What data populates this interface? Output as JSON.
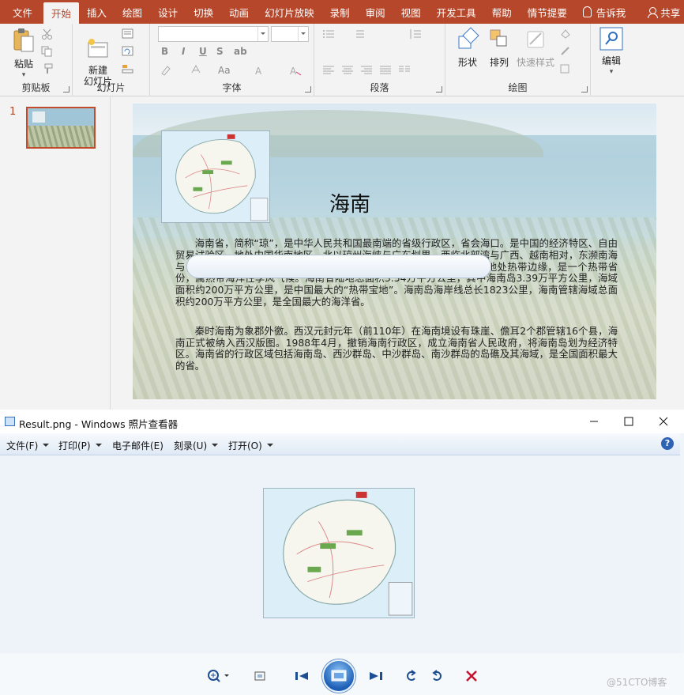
{
  "ppt": {
    "tabs": [
      "文件",
      "开始",
      "插入",
      "绘图",
      "设计",
      "切换",
      "动画",
      "幻灯片放映",
      "录制",
      "审阅",
      "视图",
      "开发工具",
      "帮助",
      "情节提要"
    ],
    "active_tab": "开始",
    "tell_me": "告诉我",
    "share": "共享",
    "groups": {
      "clipboard": {
        "label": "剪贴板",
        "paste": "粘贴"
      },
      "slides": {
        "label": "幻灯片",
        "new_slide": "新建\n幻灯片"
      },
      "font": {
        "label": "字体",
        "bold": "B",
        "italic": "I",
        "underline": "U",
        "strike": "S",
        "aa": "Aa"
      },
      "paragraph": {
        "label": "段落"
      },
      "drawing": {
        "label": "绘图",
        "shape": "形状",
        "arrange": "排列",
        "quick_style": "快速样式"
      },
      "editing": {
        "label": "编辑"
      }
    },
    "thumb_number": "1",
    "slide": {
      "title": "海南",
      "para1": "海南省，简称“琼”，是中华人民共和国最南端的省级行政区，省会海口。是中国的经济特区、自由贸易试验区。地处中国华南地区，北以琼州海峡与广东划界，西临北部湾与广西、越南相对，东濒南海与台湾对望，东南和南部在南海与菲律宾、文莱、马来西亚为邻。海南地处热带边缘，是一个热带省份，属热带海洋性季风气候。海南省陆地总面积3.54万平方公里，其中海南岛3.39万平方公里，海域面积约200万平方公里，是中国最大的“热带宝地”。海南岛海岸线总长1823公里，海南管辖海域总面积约200万平方公里，是全国最大的海洋省。",
      "para2": "秦时海南为象郡外徼。西汉元封元年（前110年）在海南境设有珠崖、儋耳2个郡管辖16个县，海南正式被纳入西汉版图。1988年4月，撤销海南行政区，成立海南省人民政府，将海南岛划为经济特区。海南省的行政区域包括海南岛、西沙群岛、中沙群岛、南沙群岛的岛礁及其海域，是全国面积最大的省。"
    }
  },
  "viewer": {
    "title": "Result.png - Windows 照片查看器",
    "menus": [
      "文件(F)",
      "打印(P)",
      "电子邮件(E)",
      "刻录(U)",
      "打开(O)"
    ],
    "help": "?",
    "watermark": "@51CTO博客"
  },
  "colors": {
    "ppt_accent": "#b7472a",
    "viewer_bg": "#eef3f9"
  }
}
